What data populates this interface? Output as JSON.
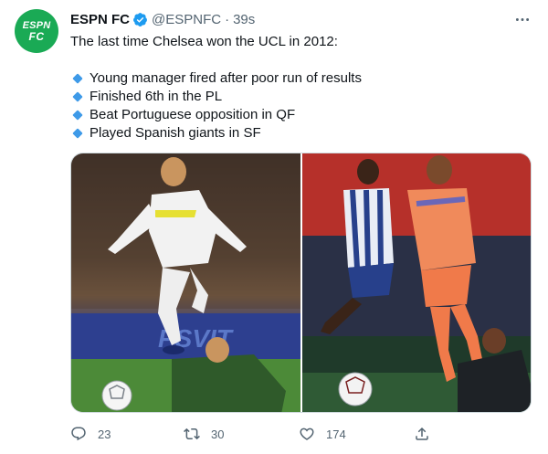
{
  "account": {
    "avatar_text_top": "ESPN",
    "avatar_text_bottom": "FC",
    "name": "ESPN FC",
    "handle": "@ESPNFC",
    "separator": "·",
    "time": "39s"
  },
  "tweet": {
    "intro": "The last time Chelsea won the UCL in 2012:",
    "bullets": [
      "Young manager fired after poor run of results",
      "Finished 6th in the PL",
      "Beat Portuguese opposition in QF",
      "Played Spanish giants in SF"
    ]
  },
  "media": {
    "photos": [
      {
        "description_icon": "photo-chelsea-2012"
      },
      {
        "description_icon": "photo-chelsea-2021"
      }
    ]
  },
  "actions": {
    "reply_count": "23",
    "retweet_count": "30",
    "like_count": "174"
  },
  "colors": {
    "brand_green": "#1aaa55",
    "verified_blue": "#1d9bf0",
    "bullet_blue": "#3e9ae8",
    "muted": "#536471"
  }
}
